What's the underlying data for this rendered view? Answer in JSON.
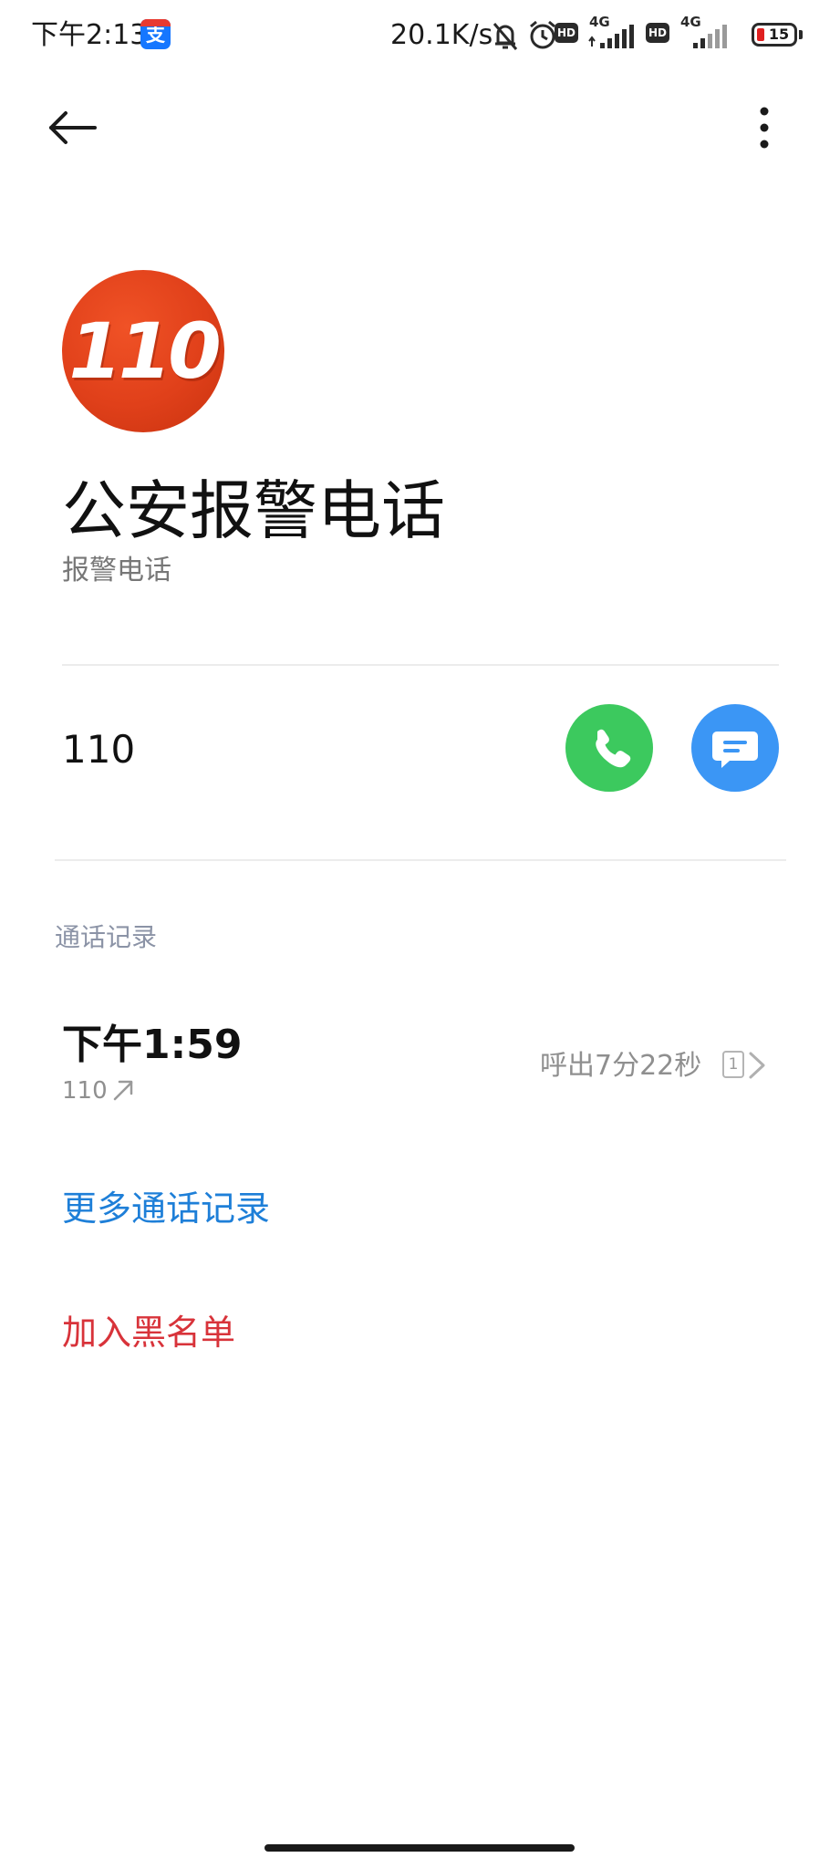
{
  "status_bar": {
    "time": "下午2:13",
    "app_icon": "支",
    "net_speed": "20.1K/s",
    "hd_label": "HD",
    "network_label": "4G",
    "battery_level": "15",
    "battery_color": "#e02020",
    "icons": [
      "alipay-icon",
      "silent-bell-icon",
      "alarm-icon",
      "hd-icon",
      "signal-icon",
      "battery-icon"
    ]
  },
  "top_bar": {
    "icons": [
      "back-arrow-icon",
      "more-vertical-icon"
    ]
  },
  "contact": {
    "avatar_text": "110",
    "avatar_color": "#e0401a",
    "name": "公安报警电话",
    "label": "报警电话"
  },
  "phone": {
    "number": "110",
    "call_color": "#3cc95e",
    "message_color": "#3b96f5"
  },
  "call_log": {
    "section_title": "通话记录",
    "entries": [
      {
        "time": "下午1:59",
        "number": "110",
        "direction_icon": "outgoing-arrow-icon",
        "summary": "呼出7分22秒",
        "sim": "1"
      }
    ]
  },
  "actions": {
    "more_logs": "更多通话记录",
    "more_logs_color": "#1e7fd8",
    "blacklist": "加入黑名单",
    "blacklist_color": "#d8333a"
  }
}
